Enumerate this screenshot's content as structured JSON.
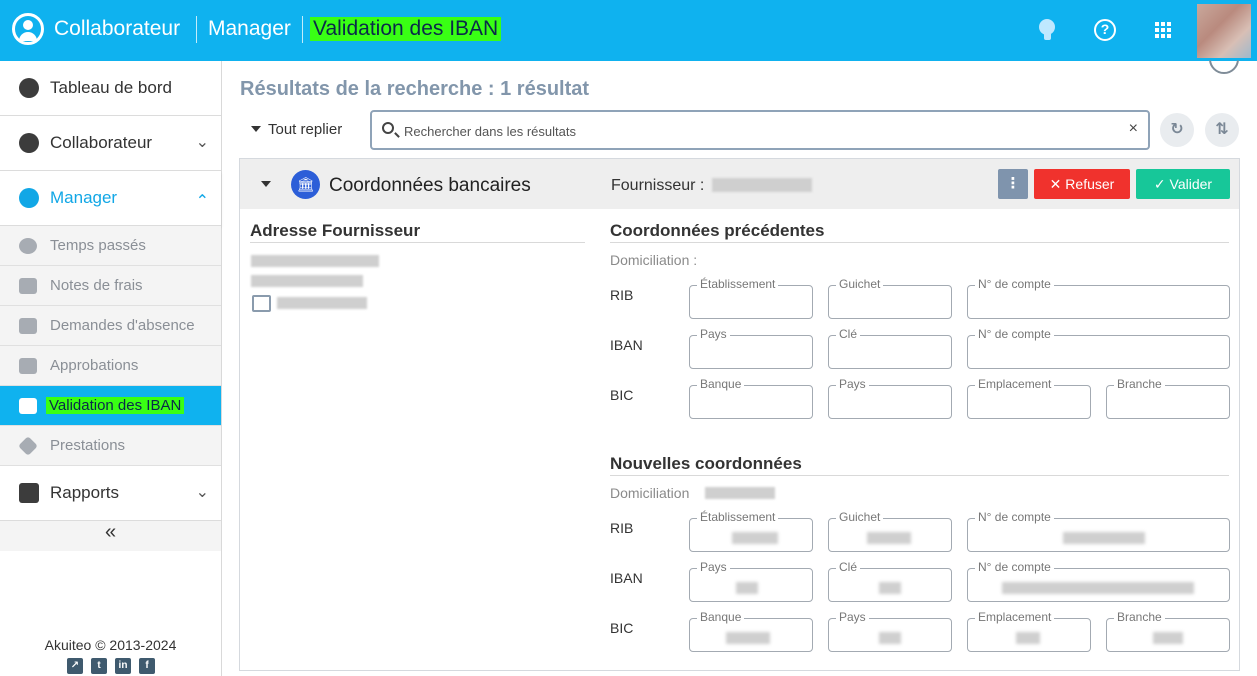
{
  "header": {
    "app": "Collaborateur",
    "section": "Manager",
    "page": "Validation des IBAN",
    "icons": [
      "lightbulb-icon",
      "help-icon",
      "apps-grid-icon"
    ]
  },
  "sidebar": {
    "items": [
      {
        "label": "Tableau de bord",
        "icon": "dashboard-icon"
      },
      {
        "label": "Collaborateur",
        "icon": "user-icon"
      },
      {
        "label": "Manager",
        "icon": "team-icon"
      },
      {
        "label": "Rapports",
        "icon": "chart-icon"
      }
    ],
    "subitems": [
      {
        "label": "Temps passés",
        "icon": "time-icon"
      },
      {
        "label": "Notes de frais",
        "icon": "receipt-icon"
      },
      {
        "label": "Demandes d'absence",
        "icon": "calendar-icon"
      },
      {
        "label": "Approbations",
        "icon": "list-icon"
      },
      {
        "label": "Validation des IBAN",
        "icon": "card-check-icon"
      },
      {
        "label": "Prestations",
        "icon": "tag-icon"
      }
    ],
    "collapse_label": "«",
    "copyright": "Akuiteo © 2013-2024",
    "socials": [
      "akuiteo-icon",
      "twitter-icon",
      "linkedin-icon",
      "facebook-icon"
    ]
  },
  "main": {
    "results_title": "Résultats de la recherche : 1 résultat",
    "collapse_all": "Tout replier",
    "search": {
      "placeholder": "Rechercher dans les résultats",
      "value": ""
    },
    "clear_label": "×"
  },
  "panel": {
    "title": "Coordonnées bancaires",
    "supplier_label": "Fournisseur :",
    "more_label": "⋮",
    "refuse_label": "Refuser",
    "refuse_icon": "✕",
    "validate_label": "Valider",
    "validate_icon": "✓",
    "colors": {
      "refuse": "#f0322d",
      "validate": "#17c799",
      "accent": "#0fb2ef"
    }
  },
  "address": {
    "title": "Adresse Fournisseur"
  },
  "previous": {
    "title": "Coordonnées précédentes",
    "domiciliation": "Domiciliation :",
    "rows": {
      "rib": "RIB",
      "iban": "IBAN",
      "bic": "BIC"
    },
    "fields": {
      "etablissement": "Établissement",
      "guichet": "Guichet",
      "compte": "N° de compte",
      "pays": "Pays",
      "cle": "Clé",
      "banque": "Banque",
      "emplacement": "Emplacement",
      "branche": "Branche"
    }
  },
  "new": {
    "title": "Nouvelles coordonnées",
    "domiciliation": "Domiciliation"
  }
}
